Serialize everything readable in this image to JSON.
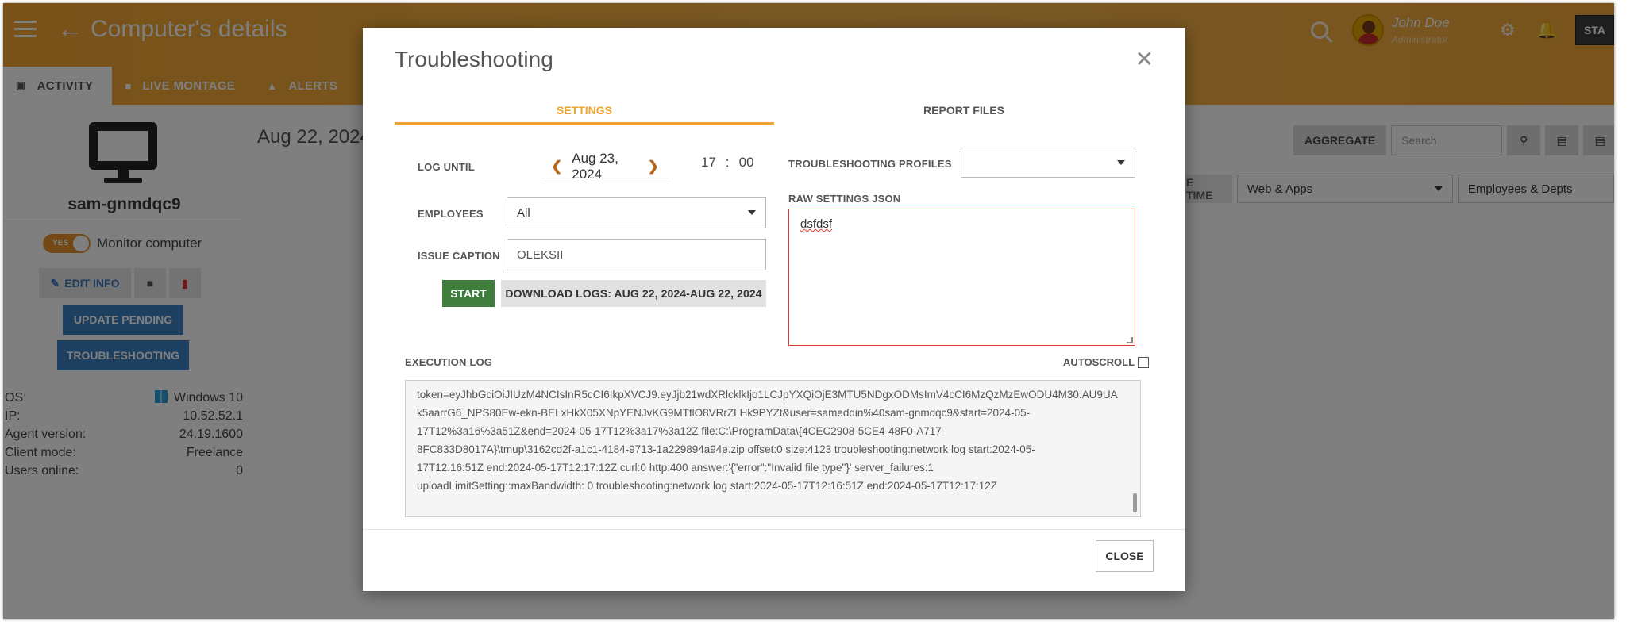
{
  "header": {
    "title": "Computer's details",
    "user_name": "John Doe",
    "user_role": "Administrator",
    "status_button": "STA",
    "tabs": [
      {
        "icon": "monitor-icon",
        "label": "ACTIVITY"
      },
      {
        "icon": "video-camera-icon",
        "label": "LIVE MONTAGE"
      },
      {
        "icon": "bell-icon",
        "label": "ALERTS"
      }
    ]
  },
  "computer": {
    "name": "sam-gnmdqc9",
    "monitor_toggle": "YES",
    "monitor_label": "Monitor computer",
    "edit_label": "EDIT INFO",
    "update_label": "UPDATE PENDING",
    "troubleshoot_label": "TROUBLESHOOTING",
    "info": [
      {
        "label": "OS:",
        "value": "Windows 10"
      },
      {
        "label": "IP:",
        "value": "10.52.52.1"
      },
      {
        "label": "Agent version:",
        "value": "24.19.1600"
      },
      {
        "label": "Client mode:",
        "value": "Freelance"
      },
      {
        "label": "Users online:",
        "value": "0"
      }
    ]
  },
  "main": {
    "date_title": "Aug 22, 2024",
    "aggregate_label": "AGGREGATE",
    "search_placeholder": "Search",
    "time_chip": "E TIME",
    "web_apps_select": "Web & Apps",
    "employees_depts_select": "Employees & Depts"
  },
  "modal": {
    "title": "Troubleshooting",
    "tabs": [
      "SETTINGS",
      "REPORT FILES"
    ],
    "log_until_label": "LOG UNTIL",
    "log_until_date": "Aug 23, 2024",
    "hour": "17",
    "minute": "00",
    "employees_label": "EMPLOYEES",
    "employees_value": "All",
    "issue_caption_label": "ISSUE CAPTION",
    "issue_caption_value": "OLEKSII",
    "start_label": "START",
    "download_label": "DOWNLOAD LOGS: AUG 22, 2024-AUG 22, 2024",
    "profiles_label": "TROUBLESHOOTING PROFILES",
    "raw_json_label": "RAW SETTINGS JSON",
    "raw_json_value": "dsfdsf",
    "execution_log_label": "EXECUTION LOG",
    "autoscroll_label": "AUTOSCROLL",
    "log_lines": [
      "token=eyJhbGciOiJIUzM4NCIsInR5cCI6IkpXVCJ9.eyJjb21wdXRlcklkIjo1LCJpYXQiOjE3MTU5NDgxODMsImV4cCI6MzQzMzEwODU4M30.AU9UA",
      "k5aarrG6_NPS80Ew-ekn-BELxHkX05XNpYENJvKG9MTflO8VRrZLHk9PYZt&user=sameddin%40sam-gnmdqc9&start=2024-05-",
      "17T12%3a16%3a51Z&end=2024-05-17T12%3a17%3a12Z file:C:\\ProgramData\\{4CEC2908-5CE4-48F0-A717-",
      "8FC833D8017A}\\tmup\\3162cd2f-a1c1-4184-9713-1a229894a94e.zip offset:0 size:4123 troubleshooting:network log start:2024-05-",
      "17T12:16:51Z end:2024-05-17T12:17:12Z curl:0  http:400 answer:'{\"error\":\"Invalid file type\"}' server_failures:1",
      "uploadLimitSetting::maxBandwidth: 0 troubleshooting:network log start:2024-05-17T12:16:51Z end:2024-05-17T12:17:12Z"
    ],
    "close_label": "CLOSE"
  }
}
